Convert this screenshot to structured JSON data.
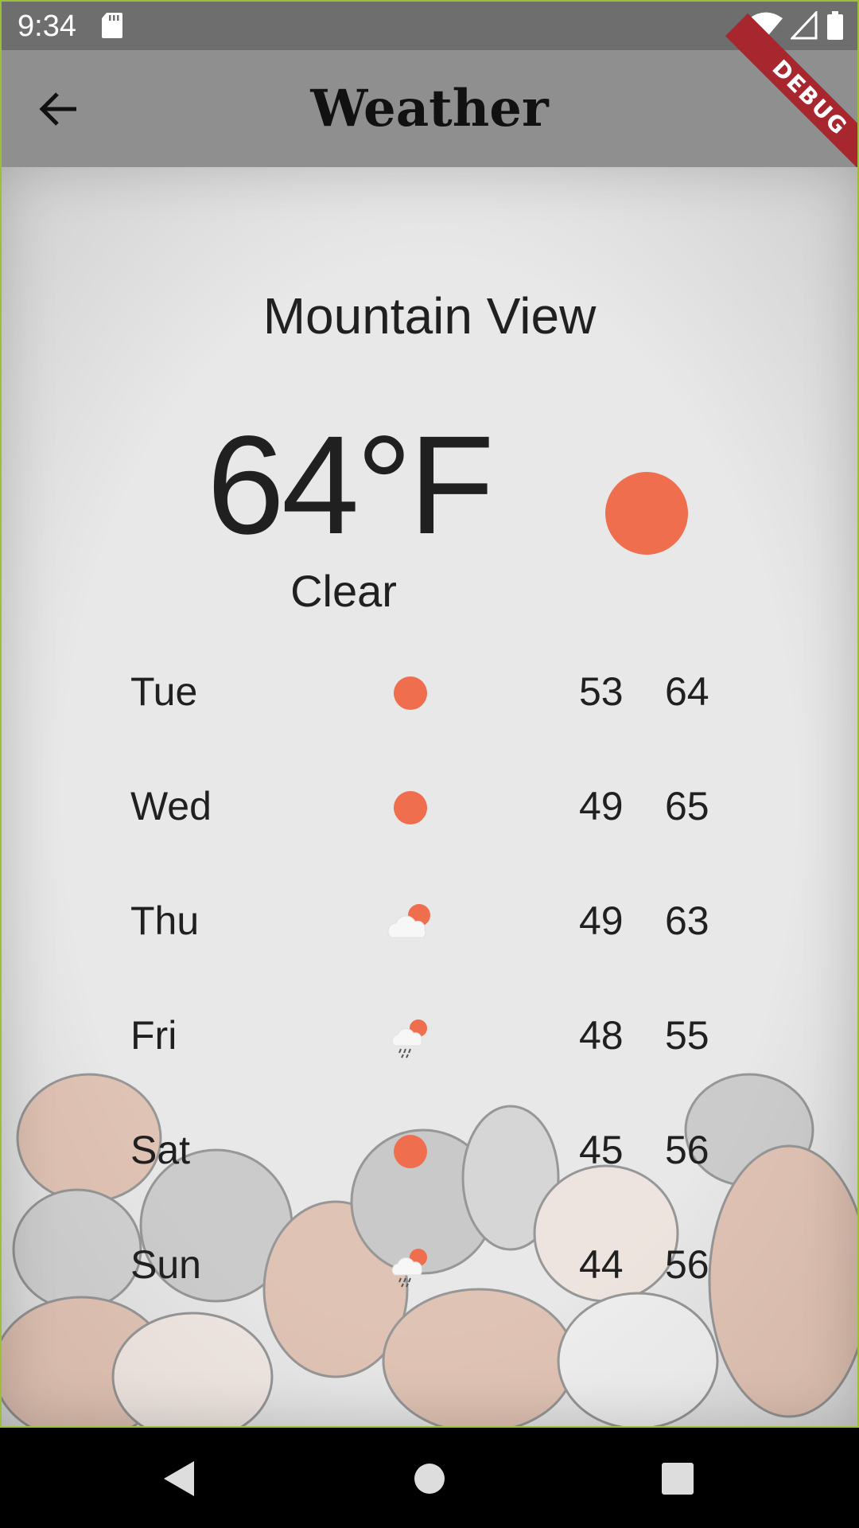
{
  "status_bar": {
    "time": "9:34",
    "icons": [
      "sd-card-icon",
      "wifi-icon",
      "signal-icon",
      "battery-icon"
    ]
  },
  "app_bar": {
    "title": "Weather",
    "back_icon": "arrow-back-icon",
    "debug_banner": "DEBUG"
  },
  "current": {
    "city": "Mountain View",
    "temperature": "64°F",
    "condition": "Clear",
    "icon": "sun-icon"
  },
  "forecast": [
    {
      "day": "Tue",
      "icon": "sun-icon",
      "low": "53",
      "high": "64"
    },
    {
      "day": "Wed",
      "icon": "sun-icon",
      "low": "49",
      "high": "65"
    },
    {
      "day": "Thu",
      "icon": "partly-cloudy-icon",
      "low": "49",
      "high": "63"
    },
    {
      "day": "Fri",
      "icon": "rain-icon",
      "low": "48",
      "high": "55"
    },
    {
      "day": "Sat",
      "icon": "sun-icon",
      "low": "45",
      "high": "56"
    },
    {
      "day": "Sun",
      "icon": "rain-icon",
      "low": "44",
      "high": "56"
    }
  ],
  "colors": {
    "sun": "#ee6e4e",
    "app_bar": "#8f8f8f",
    "status_bar": "#6e6e6e",
    "background": "#e6e6e6",
    "debug": "#a8262e"
  },
  "nav_bar": {
    "icons": [
      "nav-back-icon",
      "nav-home-icon",
      "nav-recents-icon"
    ]
  }
}
